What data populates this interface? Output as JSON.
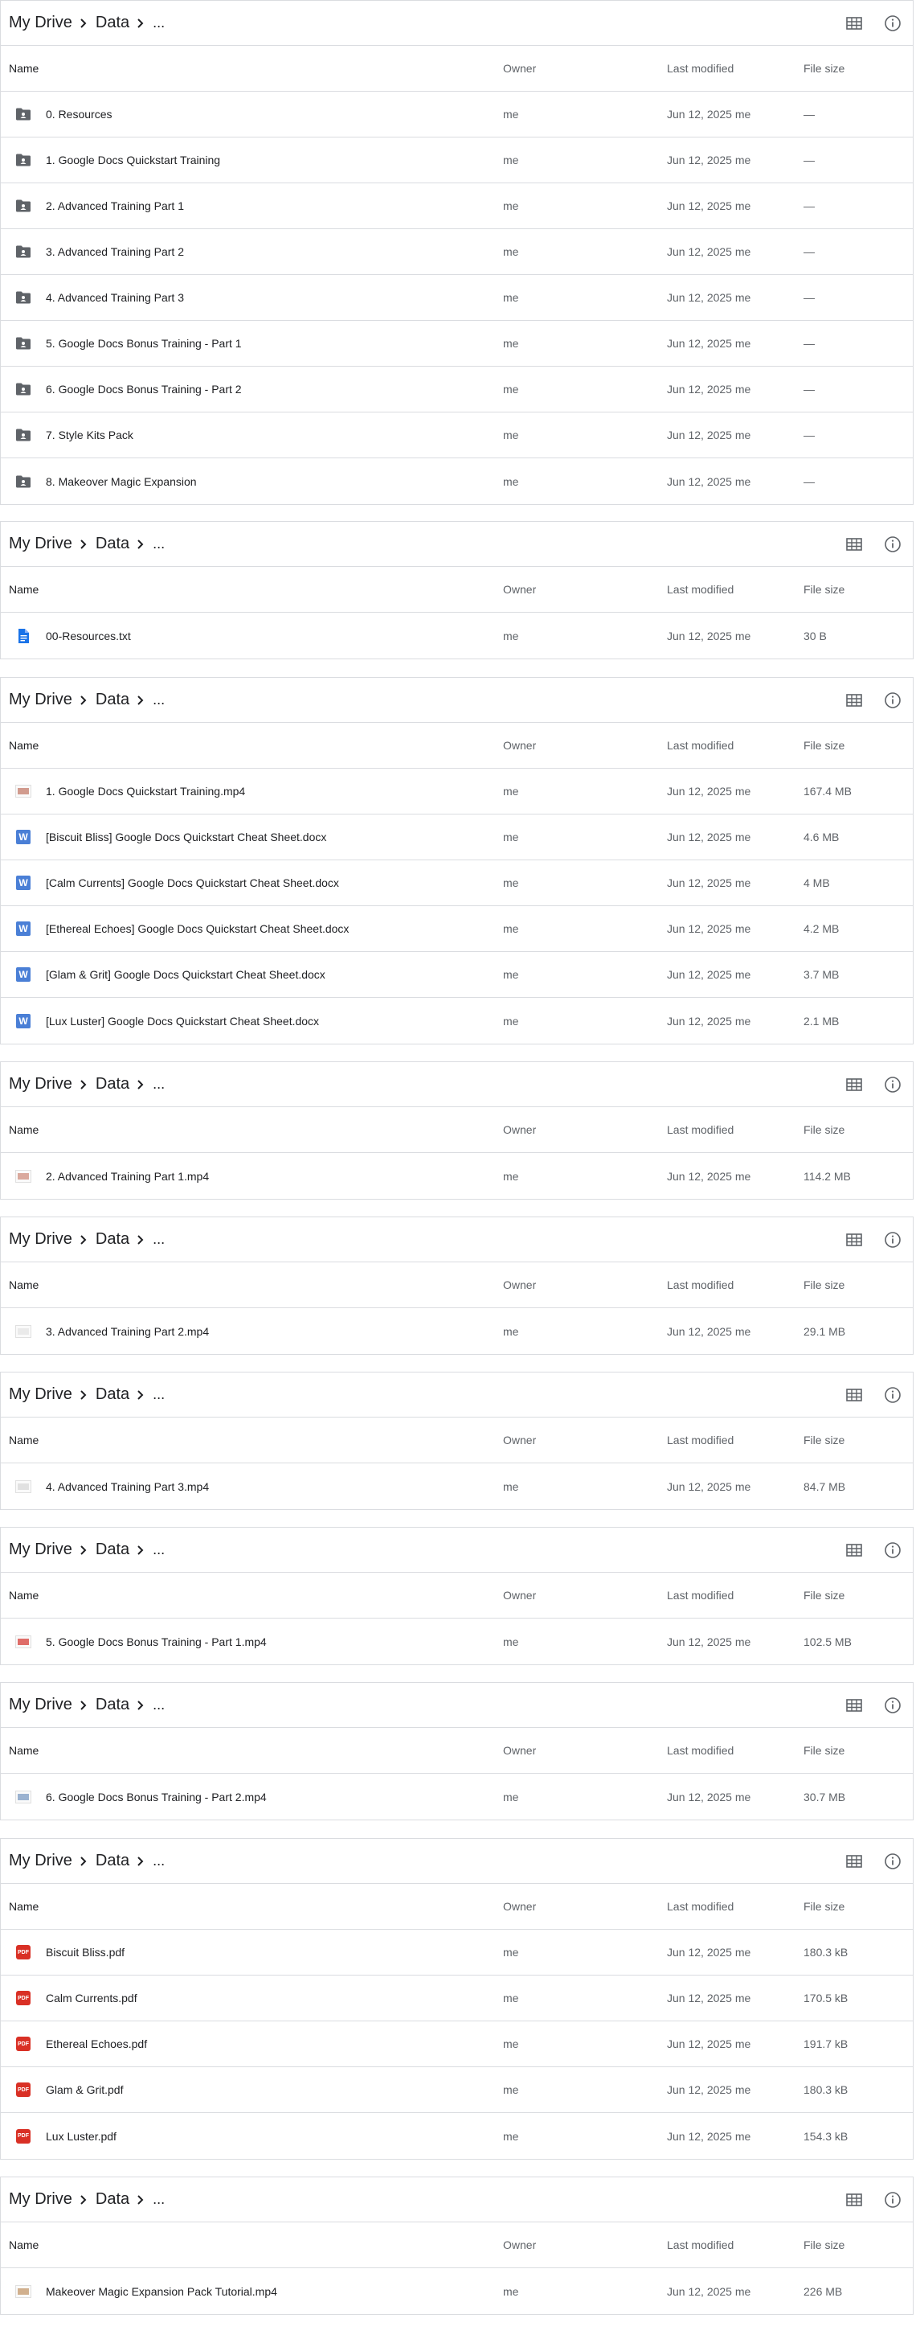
{
  "columns": {
    "name": "Name",
    "owner": "Owner",
    "modified": "Last modified",
    "size": "File size"
  },
  "breadcrumb": {
    "root": "My Drive",
    "folder": "Data",
    "more": "..."
  },
  "icons": {
    "grid": "grid-view-icon",
    "info": "info-icon",
    "chevron": "chevron-right-icon"
  },
  "colors": {
    "folder": "#5f6368",
    "doc": "#1a73e8",
    "word": "#4a7fd6",
    "pdf": "#d93025",
    "border": "#dadce0",
    "muted": "#5f6368"
  },
  "panels": [
    {
      "files": [
        {
          "type": "folder",
          "name": "0. Resources",
          "owner": "me",
          "modified": "Jun 12, 2025 me",
          "size": "—"
        },
        {
          "type": "folder",
          "name": "1. Google Docs Quickstart Training",
          "owner": "me",
          "modified": "Jun 12, 2025 me",
          "size": "—"
        },
        {
          "type": "folder",
          "name": "2. Advanced Training Part 1",
          "owner": "me",
          "modified": "Jun 12, 2025 me",
          "size": "—"
        },
        {
          "type": "folder",
          "name": "3. Advanced Training Part 2",
          "owner": "me",
          "modified": "Jun 12, 2025 me",
          "size": "—"
        },
        {
          "type": "folder",
          "name": "4. Advanced Training Part 3",
          "owner": "me",
          "modified": "Jun 12, 2025 me",
          "size": "—"
        },
        {
          "type": "folder",
          "name": "5. Google Docs Bonus Training - Part 1",
          "owner": "me",
          "modified": "Jun 12, 2025 me",
          "size": "—"
        },
        {
          "type": "folder",
          "name": "6. Google Docs Bonus Training - Part 2",
          "owner": "me",
          "modified": "Jun 12, 2025 me",
          "size": "—"
        },
        {
          "type": "folder",
          "name": "7. Style Kits Pack",
          "owner": "me",
          "modified": "Jun 12, 2025 me",
          "size": "—"
        },
        {
          "type": "folder",
          "name": "8. Makeover Magic Expansion",
          "owner": "me",
          "modified": "Jun 12, 2025 me",
          "size": "—"
        }
      ]
    },
    {
      "files": [
        {
          "type": "doc",
          "name": "00-Resources.txt",
          "owner": "me",
          "modified": "Jun 12, 2025 me",
          "size": "30 B"
        }
      ]
    },
    {
      "files": [
        {
          "type": "video",
          "thumb": "#c98a7a",
          "name": "1. Google Docs Quickstart Training.mp4",
          "owner": "me",
          "modified": "Jun 12, 2025 me",
          "size": "167.4 MB"
        },
        {
          "type": "word",
          "name": "[Biscuit Bliss] Google Docs Quickstart Cheat Sheet.docx",
          "owner": "me",
          "modified": "Jun 12, 2025 me",
          "size": "4.6 MB"
        },
        {
          "type": "word",
          "name": "[Calm Currents] Google Docs Quickstart Cheat Sheet.docx",
          "owner": "me",
          "modified": "Jun 12, 2025 me",
          "size": "4 MB"
        },
        {
          "type": "word",
          "name": "[Ethereal Echoes] Google Docs Quickstart Cheat Sheet.docx",
          "owner": "me",
          "modified": "Jun 12, 2025 me",
          "size": "4.2 MB"
        },
        {
          "type": "word",
          "name": "[Glam & Grit] Google Docs Quickstart Cheat Sheet.docx",
          "owner": "me",
          "modified": "Jun 12, 2025 me",
          "size": "3.7 MB"
        },
        {
          "type": "word",
          "name": "[Lux Luster] Google Docs Quickstart Cheat Sheet.docx",
          "owner": "me",
          "modified": "Jun 12, 2025 me",
          "size": "2.1 MB"
        }
      ]
    },
    {
      "files": [
        {
          "type": "video",
          "thumb": "#d49a8c",
          "name": "2. Advanced Training Part 1.mp4",
          "owner": "me",
          "modified": "Jun 12, 2025 me",
          "size": "114.2 MB"
        }
      ]
    },
    {
      "files": [
        {
          "type": "video",
          "thumb": "#e6e6e6",
          "name": "3. Advanced Training Part 2.mp4",
          "owner": "me",
          "modified": "Jun 12, 2025 me",
          "size": "29.1 MB"
        }
      ]
    },
    {
      "files": [
        {
          "type": "video",
          "thumb": "#dcdcdc",
          "name": "4. Advanced Training Part 3.mp4",
          "owner": "me",
          "modified": "Jun 12, 2025 me",
          "size": "84.7 MB"
        }
      ]
    },
    {
      "files": [
        {
          "type": "video",
          "thumb": "#d9534f",
          "name": "5. Google Docs Bonus Training - Part 1.mp4",
          "owner": "me",
          "modified": "Jun 12, 2025 me",
          "size": "102.5 MB"
        }
      ]
    },
    {
      "files": [
        {
          "type": "video",
          "thumb": "#8aa4c8",
          "name": "6. Google Docs Bonus Training - Part 2.mp4",
          "owner": "me",
          "modified": "Jun 12, 2025 me",
          "size": "30.7 MB"
        }
      ]
    },
    {
      "files": [
        {
          "type": "pdf",
          "name": "Biscuit Bliss.pdf",
          "owner": "me",
          "modified": "Jun 12, 2025 me",
          "size": "180.3 kB"
        },
        {
          "type": "pdf",
          "name": "Calm Currents.pdf",
          "owner": "me",
          "modified": "Jun 12, 2025 me",
          "size": "170.5 kB"
        },
        {
          "type": "pdf",
          "name": "Ethereal Echoes.pdf",
          "owner": "me",
          "modified": "Jun 12, 2025 me",
          "size": "191.7 kB"
        },
        {
          "type": "pdf",
          "name": "Glam & Grit.pdf",
          "owner": "me",
          "modified": "Jun 12, 2025 me",
          "size": "180.3 kB"
        },
        {
          "type": "pdf",
          "name": "Lux Luster.pdf",
          "owner": "me",
          "modified": "Jun 12, 2025 me",
          "size": "154.3 kB"
        }
      ]
    },
    {
      "files": [
        {
          "type": "video",
          "thumb": "#c9a27a",
          "name": "Makeover Magic Expansion Pack Tutorial.mp4",
          "owner": "me",
          "modified": "Jun 12, 2025 me",
          "size": "226 MB"
        }
      ]
    }
  ]
}
